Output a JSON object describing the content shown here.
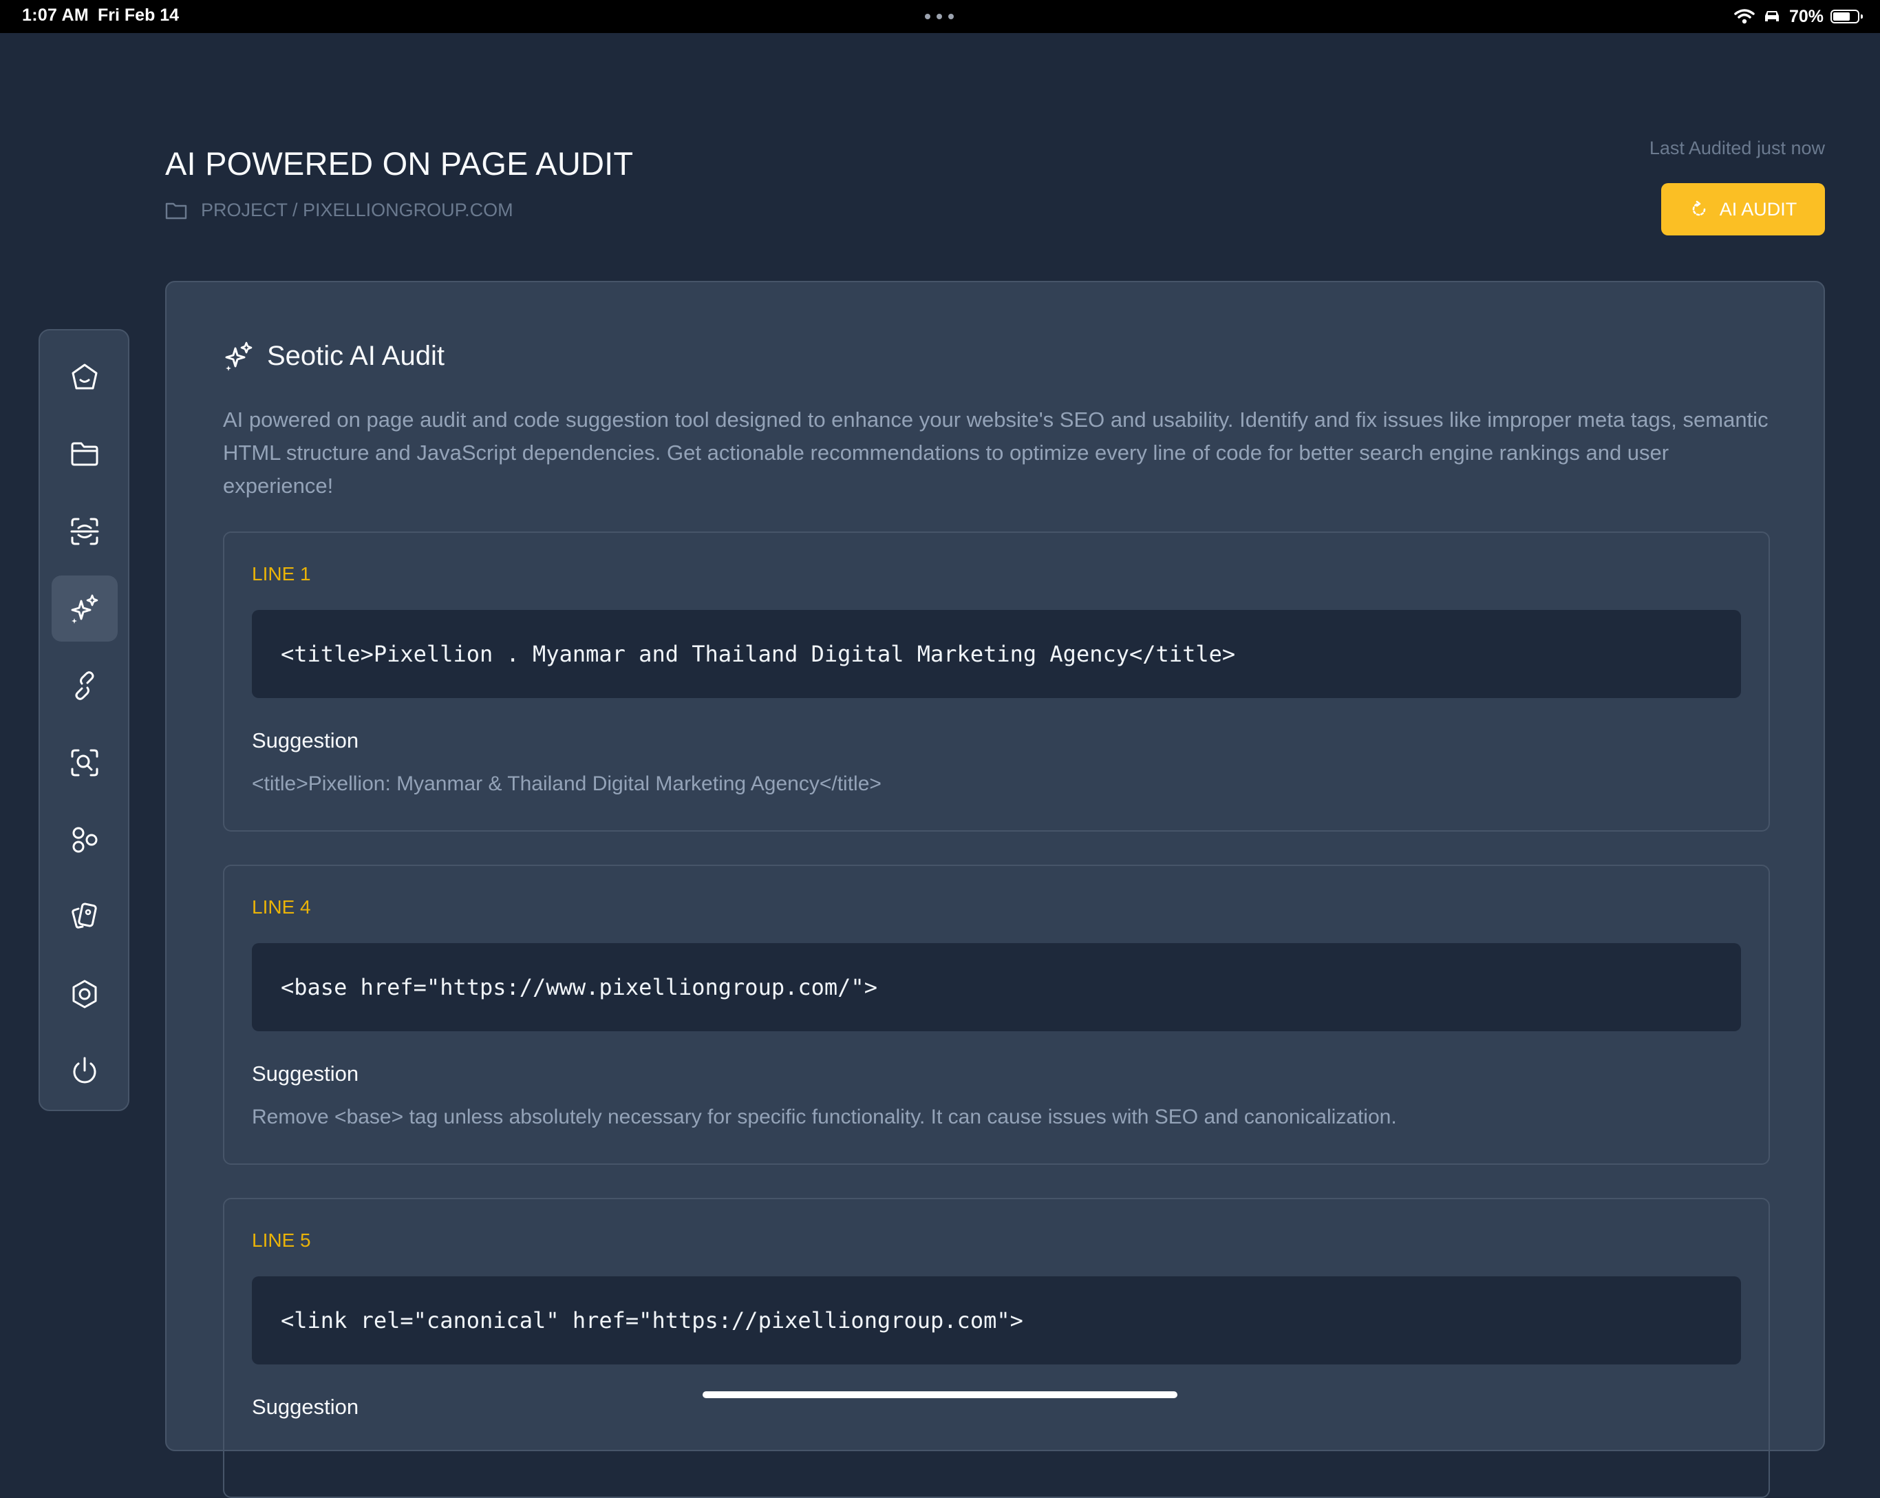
{
  "status_bar": {
    "time": "1:07 AM",
    "date": "Fri Feb 14",
    "battery": "70%",
    "battery_level": 0.7
  },
  "header": {
    "title": "AI POWERED ON PAGE AUDIT",
    "breadcrumb": "PROJECT / PIXELLIONGROUP.COM",
    "last_audited": "Last Audited just now",
    "audit_button": "AI AUDIT"
  },
  "sidebar": {
    "items": [
      {
        "icon": "home-icon",
        "active": false
      },
      {
        "icon": "folder-icon",
        "active": false
      },
      {
        "icon": "scan-icon",
        "active": false
      },
      {
        "icon": "sparkles-icon",
        "active": true
      },
      {
        "icon": "link-icon",
        "active": false
      },
      {
        "icon": "search-scan-icon",
        "active": false
      },
      {
        "icon": "shapes-icon",
        "active": false
      },
      {
        "icon": "cards-icon",
        "active": false
      },
      {
        "icon": "settings-icon",
        "active": false
      },
      {
        "icon": "power-icon",
        "active": false
      }
    ]
  },
  "card": {
    "title": "Seotic AI Audit",
    "description": "AI powered on page audit and code suggestion tool designed to enhance your website's SEO and usability. Identify and fix issues like improper meta tags, semantic HTML structure and JavaScript dependencies. Get actionable recommendations to optimize every line of code for better search engine rankings and user experience!",
    "suggestion_heading": "Suggestion",
    "issues": [
      {
        "line": "LINE 1",
        "code": "<title>Pixellion . Myanmar and Thailand Digital Marketing Agency</title>",
        "suggestion": "<title>Pixellion: Myanmar & Thailand Digital Marketing Agency</title>"
      },
      {
        "line": "LINE 4",
        "code": "<base href=\"https://www.pixelliongroup.com/\">",
        "suggestion": "Remove <base> tag unless absolutely necessary for specific functionality. It can cause issues with SEO and canonicalization."
      },
      {
        "line": "LINE 5",
        "code": "<link rel=\"canonical\" href=\"https://pixelliongroup.com\">",
        "suggestion": ""
      }
    ]
  },
  "colors": {
    "background": "#1e293b",
    "card": "#334155",
    "accent": "#fbbf24",
    "line_label": "#eab308",
    "muted_text": "#94a3b8"
  }
}
